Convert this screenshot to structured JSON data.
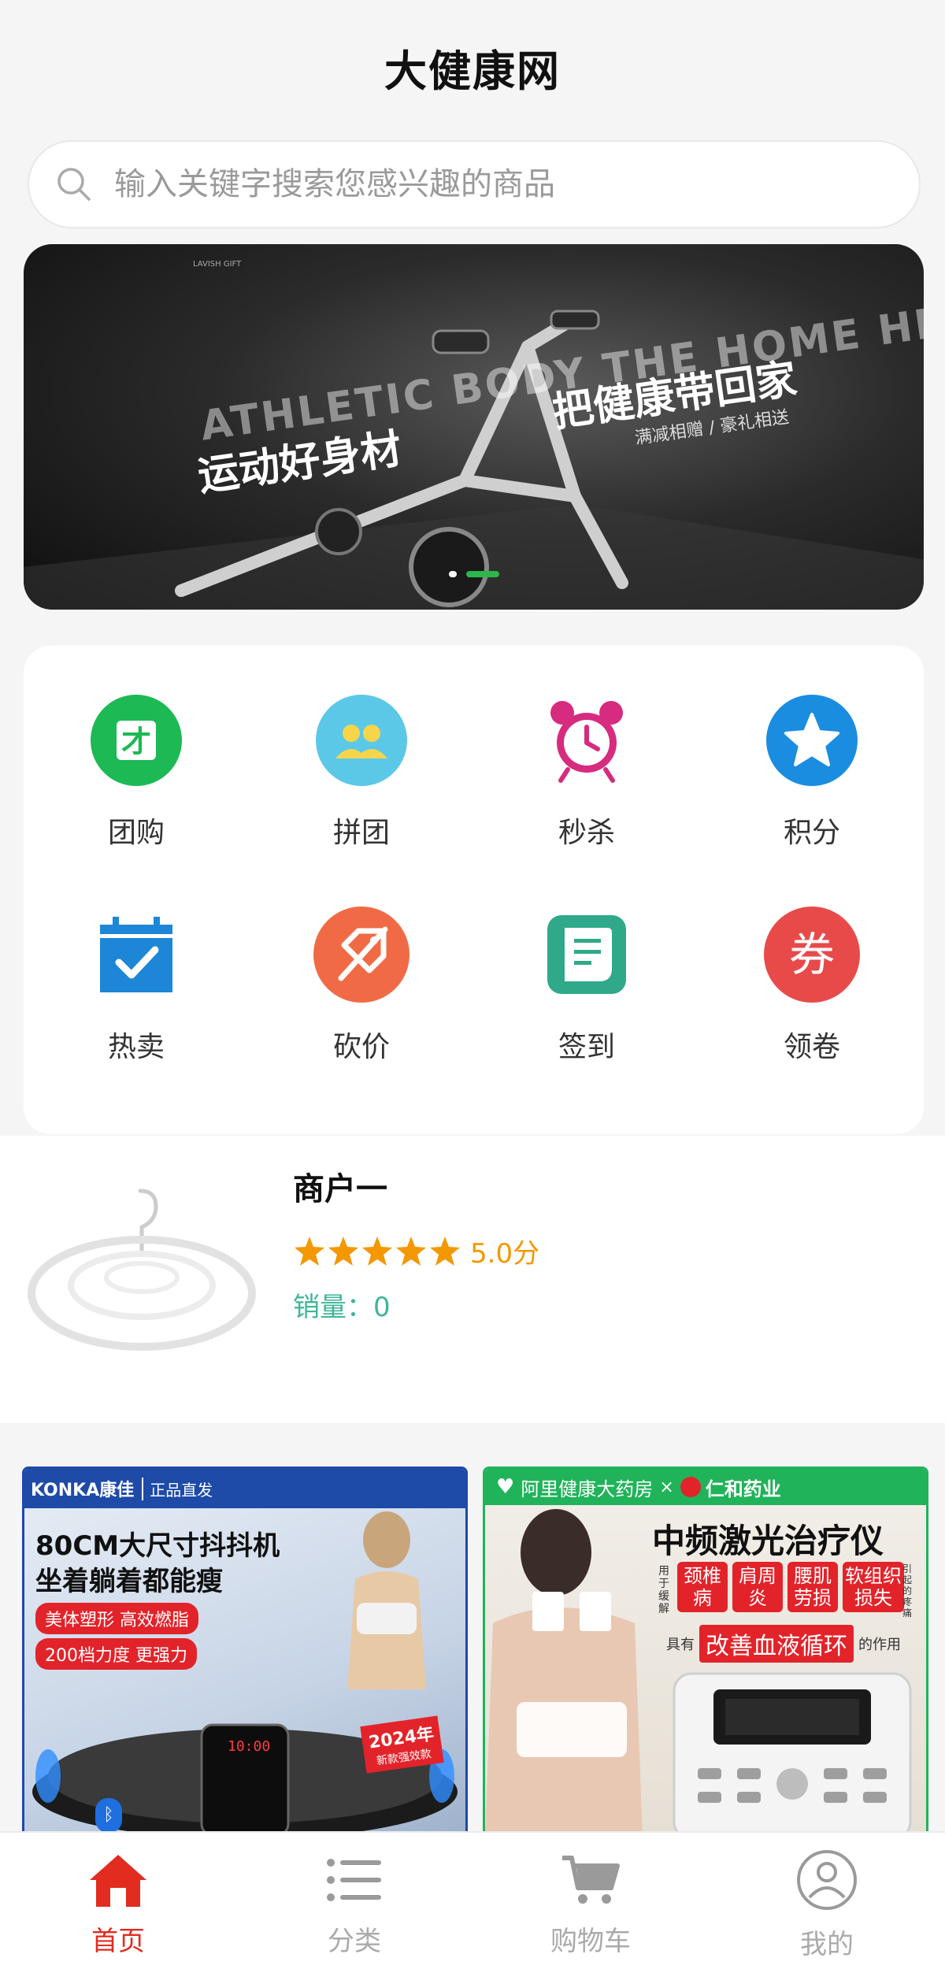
{
  "header": {
    "title": "大健康网"
  },
  "search": {
    "placeholder": "输入关键字搜索您感兴趣的商品"
  },
  "banner": {
    "tiny_text": "LAVISH GIFT",
    "english_text": "ATHLETIC BODY  THE HOME HEAL",
    "slogan_left": "运动好身材",
    "slogan_right": "把健康带回家",
    "sub_text": "满减相赠 / 豪礼相送",
    "active_slide": 2,
    "slide_count": 2
  },
  "menu": {
    "items": [
      {
        "label": "团购",
        "icon": "group-buy-icon",
        "color": "#1db954"
      },
      {
        "label": "拼团",
        "icon": "team-icon",
        "color": "#5bc8e8"
      },
      {
        "label": "秒杀",
        "icon": "alarm-clock-icon",
        "color": "#d62b7e"
      },
      {
        "label": "积分",
        "icon": "star-icon",
        "color": "#1a8de0"
      },
      {
        "label": "热卖",
        "icon": "calendar-check-icon",
        "color": "#1e86d6"
      },
      {
        "label": "砍价",
        "icon": "price-tag-icon",
        "color": "#f06b45"
      },
      {
        "label": "签到",
        "icon": "sign-in-document-icon",
        "color": "#2fa98a"
      },
      {
        "label": "领卷",
        "icon": "coupon-icon",
        "color": "#e84a4a"
      }
    ]
  },
  "shop": {
    "name": "商户一",
    "rating": 5,
    "rating_text": "5.0分",
    "sales_text": "销量：0"
  },
  "products": [
    {
      "brand": "KONKA康佳",
      "badge": "正品直发",
      "headline_1": "80CM大尺寸抖抖机",
      "headline_2": "坐着躺着都能瘦",
      "tag_1": "美体塑形 高效燃脂",
      "tag_2": "200档力度 更强力",
      "year_tag": "2024年",
      "year_sub": "新款强效款",
      "display": "10:00"
    },
    {
      "store": "阿里健康大药房",
      "cross": "×",
      "partner": "仁和药业",
      "headline": "中频激光治疗仪",
      "side_left": "用于缓解",
      "side_right": "引起的疼痛",
      "conditions": [
        "颈椎病",
        "肩周炎",
        "腰肌劳损",
        "软组织损失"
      ],
      "effect_prefix": "具有",
      "effect": "改善血液循环",
      "effect_suffix": "的作用"
    }
  ],
  "tabbar": {
    "items": [
      {
        "label": "首页",
        "icon": "home-icon",
        "active": true
      },
      {
        "label": "分类",
        "icon": "list-icon",
        "active": false
      },
      {
        "label": "购物车",
        "icon": "cart-icon",
        "active": false
      },
      {
        "label": "我的",
        "icon": "user-icon",
        "active": false
      }
    ]
  },
  "colors": {
    "accent_red": "#e12c1f",
    "rating_orange": "#f39800",
    "sales_green": "#3fb59a"
  }
}
